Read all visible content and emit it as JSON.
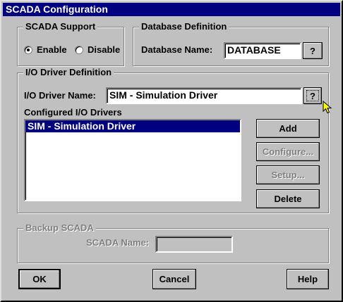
{
  "window": {
    "title": "SCADA Configuration"
  },
  "scada_support": {
    "legend": "SCADA Support",
    "enable_label": "Enable",
    "disable_label": "Disable",
    "selected": "Enable"
  },
  "database": {
    "legend": "Database Definition",
    "name_label": "Database Name:",
    "name_value": "DATABASE",
    "browse_label": "?"
  },
  "io_driver": {
    "legend": "I/O Driver Definition",
    "name_label": "I/O Driver Name:",
    "name_value": "SIM - Simulation Driver",
    "browse_label": "?",
    "configured_label": "Configured I/O Drivers",
    "configured_items": [
      "SIM - Simulation Driver"
    ],
    "selected_index": 0,
    "add_label": "Add",
    "configure_label": "Configure...",
    "setup_label": "Setup...",
    "delete_label": "Delete"
  },
  "backup": {
    "legend": "Backup SCADA",
    "name_label": "SCADA Name:",
    "name_value": ""
  },
  "footer": {
    "ok_label": "OK",
    "cancel_label": "Cancel",
    "help_label": "Help"
  }
}
